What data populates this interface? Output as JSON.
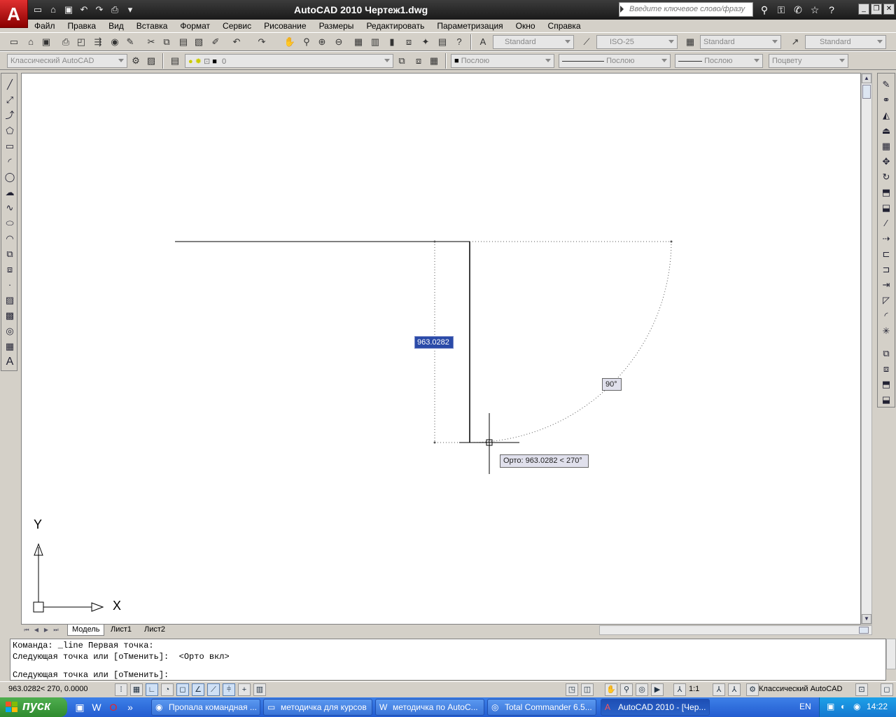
{
  "app": {
    "logo_letter": "A",
    "title": "AutoCAD 2010    Чертеж1.dwg",
    "search_placeholder": "Введите ключевое слово/фразу"
  },
  "menu": [
    "Файл",
    "Правка",
    "Вид",
    "Вставка",
    "Формат",
    "Сервис",
    "Рисование",
    "Размеры",
    "Редактировать",
    "Параметризация",
    "Окно",
    "Справка"
  ],
  "toolbar1": {
    "text_style": "Standard",
    "dim_style": "ISO-25",
    "table_style": "Standard",
    "multileader_style": "Standard"
  },
  "toolbar2": {
    "workspace": "Классический AutoCAD",
    "layer": "0",
    "color": "Послою",
    "linetype": "Послою",
    "lineweight": "Послою",
    "plotstyle": "Поцвету"
  },
  "drawing": {
    "dyn_length": "963.0282",
    "dyn_angle": "90°",
    "tooltip": "Орто: 963.0282 < 270°",
    "ucs_y": "Y",
    "ucs_x": "X"
  },
  "tabs": [
    "Модель",
    "Лист1",
    "Лист2"
  ],
  "command": {
    "line1": "Команда: _line Первая точка:",
    "line2": "Следующая точка или [оТменить]:  <Орто вкл>",
    "prompt": "Следующая точка или [оТменить]:"
  },
  "status": {
    "coords": "963.0282< 270, 0.0000",
    "scale": "1:1",
    "workspace": "Классический AutoCAD"
  },
  "taskbar": {
    "start": "пуск",
    "tasks": [
      "Пропала командная ...",
      "методичка для курсов",
      "методичка по AutoC...",
      "Total Commander 6.5...",
      "AutoCAD 2010 - [Чер..."
    ],
    "lang": "EN",
    "clock": "14:22"
  }
}
